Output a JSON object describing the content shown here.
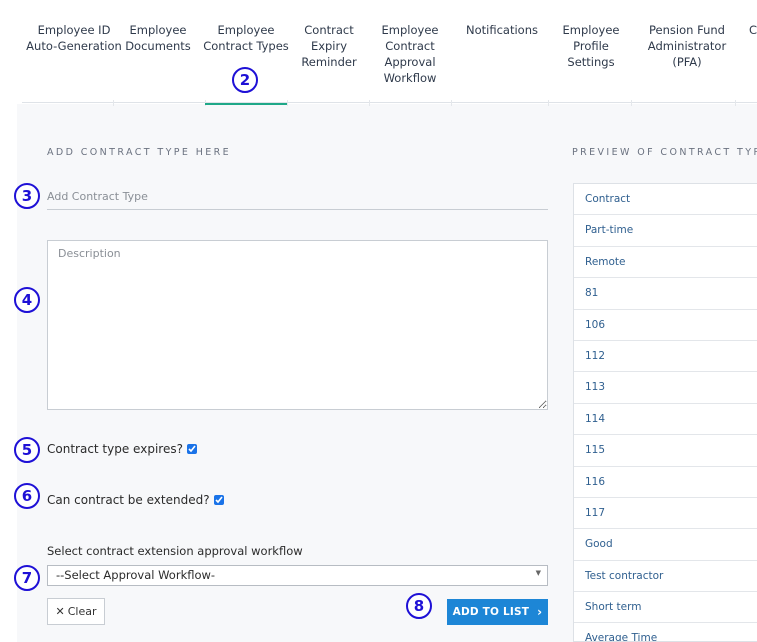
{
  "tabs": [
    {
      "label": "Employee ID\nAuto-Generation"
    },
    {
      "label": "Employee\nDocuments"
    },
    {
      "label": "Employee\nContract Types"
    },
    {
      "label": "Contract\nExpiry\nReminder"
    },
    {
      "label": "Employee\nContract\nApproval\nWorkflow"
    },
    {
      "label": "Notifications"
    },
    {
      "label": "Employee\nProfile Settings"
    },
    {
      "label": "Pension Fund\nAdministrator (PFA)"
    },
    {
      "label": "C"
    }
  ],
  "active_tab_index": 2,
  "markers": [
    "2",
    "3",
    "4",
    "5",
    "6",
    "7",
    "8"
  ],
  "form": {
    "heading": "ADD CONTRACT TYPE HERE",
    "contract_type_placeholder": "Add Contract Type",
    "description_placeholder": "Description",
    "expires_label": "Contract type expires?",
    "expires_checked": true,
    "extended_label": "Can contract be extended?",
    "extended_checked": true,
    "workflow_label": "Select contract extension approval workflow",
    "workflow_selected": "--Select Approval Workflow-",
    "clear_label": "Clear",
    "add_label": "ADD TO LIST"
  },
  "preview": {
    "heading": "PREVIEW OF CONTRACT TYPE",
    "items": [
      "Contract",
      "Part-time",
      "Remote",
      "81",
      "106",
      "112",
      "113",
      "114",
      "115",
      "116",
      "117",
      "Good",
      "Test contractor",
      "Short term",
      "Average Time"
    ]
  },
  "colors": {
    "accent_tab": "#1fa888",
    "marker": "#1e10d6",
    "primary_button": "#1d86d6",
    "link_text": "#2f5f8f"
  }
}
